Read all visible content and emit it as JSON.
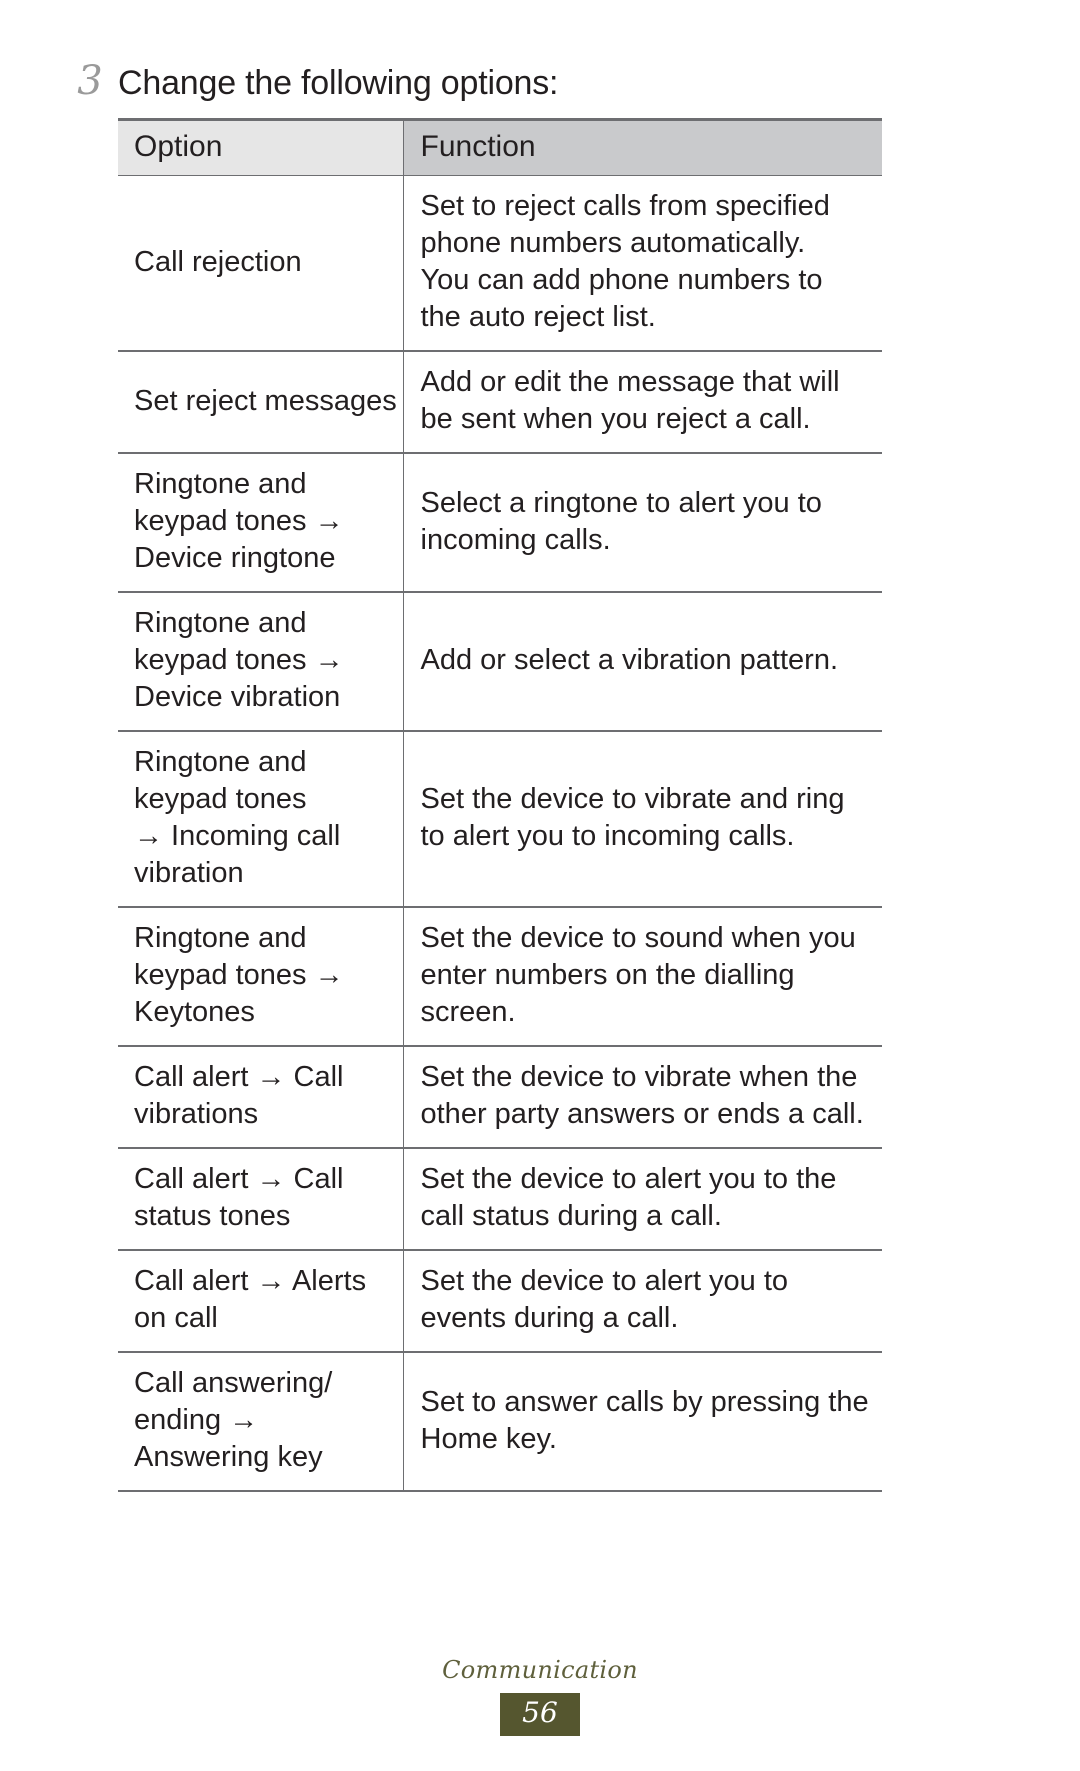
{
  "page": {
    "step_number": "3",
    "step_text": "Change the following options:"
  },
  "table": {
    "headers": {
      "option": "Option",
      "function": "Function"
    },
    "rows": [
      {
        "option": "Call rejection",
        "option_lines": [
          "Call rejection"
        ],
        "function": "Set to reject calls from specified phone numbers automatically. You can add phone numbers to the auto reject list.",
        "function_lines": [
          "Set to reject calls from specified",
          "phone numbers automatically.",
          "You can add phone numbers to",
          "the auto reject list."
        ]
      },
      {
        "option": "Set reject messages",
        "option_lines": [
          "Set reject messages"
        ],
        "function": "Add or edit the message that will be sent when you reject a call.",
        "function_lines": [
          "Add or edit the message that will",
          "be sent when you reject a call."
        ]
      },
      {
        "option": "Ringtone and keypad tones → Device ringtone",
        "option_lines": [
          "Ringtone and",
          "keypad tones →",
          "Device ringtone"
        ],
        "function": "Select a ringtone to alert you to incoming calls.",
        "function_lines": [
          "Select a ringtone to alert you to",
          "incoming calls."
        ]
      },
      {
        "option": "Ringtone and keypad tones → Device vibration",
        "option_lines": [
          "Ringtone and",
          "keypad tones →",
          "Device vibration"
        ],
        "function": "Add or select a vibration pattern.",
        "function_lines": [
          "Add or select a vibration pattern."
        ]
      },
      {
        "option": "Ringtone and keypad tones → Incoming call vibration",
        "option_lines": [
          "Ringtone and",
          "keypad tones",
          "→ Incoming call",
          "vibration"
        ],
        "function": "Set the device to vibrate and ring to alert you to incoming calls.",
        "function_lines": [
          "Set the device to vibrate and ring",
          "to alert you to incoming calls."
        ]
      },
      {
        "option": "Ringtone and keypad tones → Keytones",
        "option_lines": [
          "Ringtone and",
          "keypad tones →",
          "Keytones"
        ],
        "function": "Set the device to sound when you enter numbers on the dialling screen.",
        "function_lines": [
          "Set the device to sound when you",
          "enter numbers on the dialling",
          "screen."
        ]
      },
      {
        "option": "Call alert → Call vibrations",
        "option_lines": [
          "Call alert → Call",
          "vibrations"
        ],
        "function": "Set the device to vibrate when the other party answers or ends a call.",
        "function_lines": [
          "Set the device to vibrate when the",
          "other party answers or ends a call."
        ]
      },
      {
        "option": "Call alert → Call status tones",
        "option_lines": [
          "Call alert → Call",
          "status tones"
        ],
        "function": "Set the device to alert you to the call status during a call.",
        "function_lines": [
          "Set the device to alert you to the",
          "call status during a call."
        ]
      },
      {
        "option": "Call alert → Alerts on call",
        "option_lines": [
          "Call alert → Alerts",
          "on call"
        ],
        "function": "Set the device to alert you to events during a call.",
        "function_lines": [
          "Set the device to alert you to",
          "events during a call."
        ]
      },
      {
        "option": "Call answering/ending → Answering key",
        "option_lines": [
          "Call answering/",
          "ending →",
          "Answering key"
        ],
        "function": "Set to answer calls by pressing the Home key.",
        "function_lines": [
          "Set to answer calls by pressing the",
          "Home key."
        ]
      }
    ]
  },
  "footer": {
    "section_title": "Communication",
    "page_number": "56",
    "accent_color": "#55562f",
    "title_color": "#5f603c"
  }
}
